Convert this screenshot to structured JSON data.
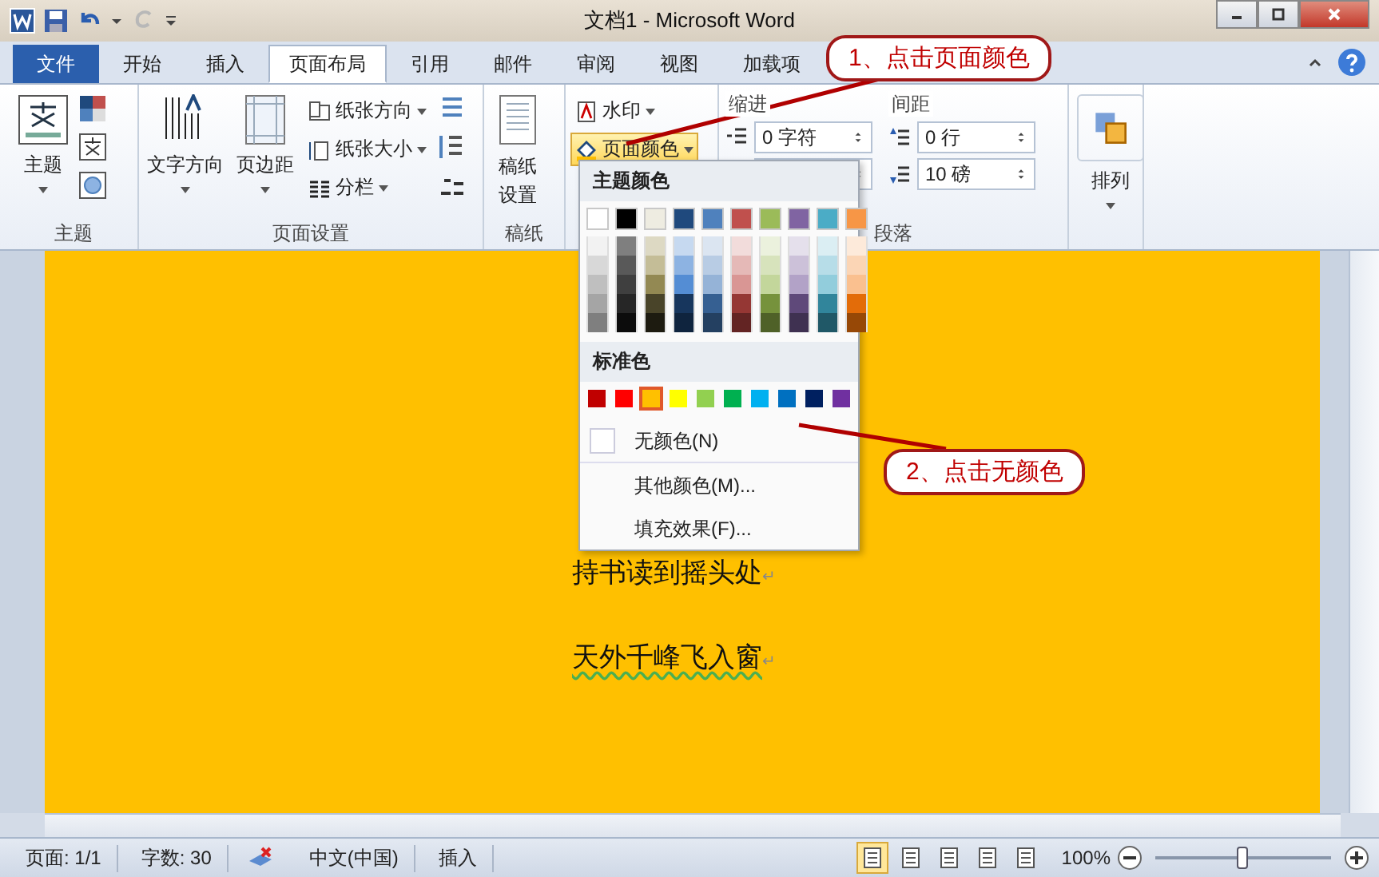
{
  "title_bar": {
    "title": "文档1 - Microsoft Word"
  },
  "tabs": [
    {
      "label": "文件",
      "kind": "file",
      "selected": false
    },
    {
      "label": "开始",
      "kind": "tab",
      "selected": false
    },
    {
      "label": "插入",
      "kind": "tab",
      "selected": false
    },
    {
      "label": "页面布局",
      "kind": "tab",
      "selected": true
    },
    {
      "label": "引用",
      "kind": "tab",
      "selected": false
    },
    {
      "label": "邮件",
      "kind": "tab",
      "selected": false
    },
    {
      "label": "审阅",
      "kind": "tab",
      "selected": false
    },
    {
      "label": "视图",
      "kind": "tab",
      "selected": false
    },
    {
      "label": "加载项",
      "kind": "tab",
      "selected": false
    }
  ],
  "ribbon": {
    "theme": {
      "label": "主题",
      "button": "主题"
    },
    "page_setup": {
      "label": "页面设置",
      "text_direction": "文字方向",
      "margins": "页边距",
      "orientation": "纸张方向",
      "size": "纸张大小",
      "columns": "分栏"
    },
    "draft": {
      "label": "稿纸",
      "button": "稿纸设置"
    },
    "background": {
      "watermark": "水印",
      "page_color": "页面颜色",
      "page_color_open": true
    },
    "paragraph": {
      "label": "段落",
      "indent_title": "缩进",
      "indent_left": "0 字符",
      "spacing_title": "间距",
      "spacing_before": "0 行",
      "spacing_after": "10 磅"
    },
    "arrange": {
      "button": "排列"
    }
  },
  "color_menu": {
    "theme_title": "主题颜色",
    "theme_columns": [
      {
        "color": "#ffffff",
        "shades": [
          {
            "color": "#f2f2f2"
          },
          {
            "color": "#d8d8d8"
          },
          {
            "color": "#bfbfbf"
          },
          {
            "color": "#a5a5a5"
          },
          {
            "color": "#7f7f7f"
          }
        ]
      },
      {
        "color": "#000000",
        "shades": [
          {
            "color": "#7f7f7f"
          },
          {
            "color": "#595959"
          },
          {
            "color": "#3f3f3f"
          },
          {
            "color": "#262626"
          },
          {
            "color": "#0c0c0c"
          }
        ]
      },
      {
        "color": "#eeece1",
        "shades": [
          {
            "color": "#ddd9c3"
          },
          {
            "color": "#c4bd97"
          },
          {
            "color": "#938953"
          },
          {
            "color": "#494429"
          },
          {
            "color": "#1d1b10"
          }
        ]
      },
      {
        "color": "#1f497d",
        "shades": [
          {
            "color": "#c6d9f0"
          },
          {
            "color": "#8db3e2"
          },
          {
            "color": "#548dd4"
          },
          {
            "color": "#17365d"
          },
          {
            "color": "#0f243e"
          }
        ]
      },
      {
        "color": "#4f81bd",
        "shades": [
          {
            "color": "#dbe5f1"
          },
          {
            "color": "#b8cce4"
          },
          {
            "color": "#95b3d7"
          },
          {
            "color": "#366092"
          },
          {
            "color": "#244061"
          }
        ]
      },
      {
        "color": "#c0504d",
        "shades": [
          {
            "color": "#f2dcdb"
          },
          {
            "color": "#e5b9b7"
          },
          {
            "color": "#d99694"
          },
          {
            "color": "#953734"
          },
          {
            "color": "#632423"
          }
        ]
      },
      {
        "color": "#9bbb59",
        "shades": [
          {
            "color": "#ebf1dd"
          },
          {
            "color": "#d7e3bc"
          },
          {
            "color": "#c3d69b"
          },
          {
            "color": "#76923c"
          },
          {
            "color": "#4f6128"
          }
        ]
      },
      {
        "color": "#8064a2",
        "shades": [
          {
            "color": "#e5e0ec"
          },
          {
            "color": "#ccc1d9"
          },
          {
            "color": "#b2a2c7"
          },
          {
            "color": "#5f497a"
          },
          {
            "color": "#3f3151"
          }
        ]
      },
      {
        "color": "#4bacc6",
        "shades": [
          {
            "color": "#dbeef3"
          },
          {
            "color": "#b7dde8"
          },
          {
            "color": "#92cddc"
          },
          {
            "color": "#31859b"
          },
          {
            "color": "#205867"
          }
        ]
      },
      {
        "color": "#f79646",
        "shades": [
          {
            "color": "#fdeada"
          },
          {
            "color": "#fbd5b5"
          },
          {
            "color": "#fac08f"
          },
          {
            "color": "#e36c09"
          },
          {
            "color": "#974806"
          }
        ]
      }
    ],
    "standard_title": "标准色",
    "standard": [
      {
        "color": "#c00000",
        "selected": false
      },
      {
        "color": "#ff0000",
        "selected": false
      },
      {
        "color": "#ffc000",
        "selected": true
      },
      {
        "color": "#ffff00",
        "selected": false
      },
      {
        "color": "#92d050",
        "selected": false
      },
      {
        "color": "#00b050",
        "selected": false
      },
      {
        "color": "#00b0f0",
        "selected": false
      },
      {
        "color": "#0070c0",
        "selected": false
      },
      {
        "color": "#002060",
        "selected": false
      },
      {
        "color": "#7030a0",
        "selected": false
      }
    ],
    "items": [
      {
        "label": "无颜色(N)",
        "kind": "swatch"
      },
      {
        "label": "其他颜色(M)...",
        "kind": "plain"
      },
      {
        "label": "填充效果(F)...",
        "kind": "plain"
      }
    ]
  },
  "document": {
    "lines": [
      {
        "text": "持书读到摇头处",
        "mark": "↵",
        "grammar_flag": false
      },
      {
        "text": "天外千峰飞入窗",
        "mark": "↵",
        "grammar_flag": true
      }
    ]
  },
  "status_bar": {
    "page": "页面: 1/1",
    "words": "字数: 30",
    "language": "中文(中国)",
    "mode": "插入",
    "views": [
      {
        "selected": true
      },
      {
        "selected": false
      },
      {
        "selected": false
      },
      {
        "selected": false
      },
      {
        "selected": false
      }
    ],
    "zoom": "100%",
    "level": 0.5
  },
  "annotations": [
    {
      "text": "1、点击页面颜色"
    },
    {
      "text": "2、点击无颜色"
    }
  ]
}
